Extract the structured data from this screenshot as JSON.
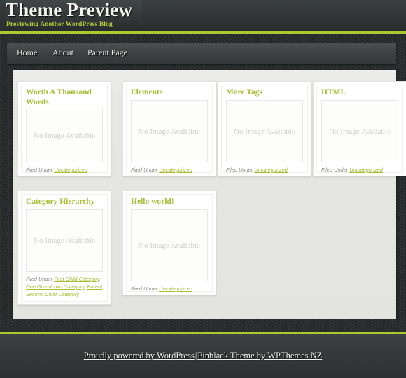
{
  "site": {
    "title": "Theme Preview",
    "description": "Previewing Another WordPress Blog",
    "accent_color": "#aec92c",
    "title_color": "#f4f4f0",
    "background_color": "#2c3030"
  },
  "nav": {
    "items": [
      {
        "label": "Home"
      },
      {
        "label": "About"
      },
      {
        "label": "Parent Page"
      }
    ]
  },
  "posts": [
    {
      "title": "Worth A Thousand Words",
      "thumb_label": "No Image Available",
      "filed_under_label": "Filed Under",
      "categories": [
        "Uncategorized"
      ]
    },
    {
      "title": "Elements",
      "thumb_label": "No Image Available",
      "filed_under_label": "Filed Under",
      "categories": [
        "Uncategorized"
      ]
    },
    {
      "title": "More Tags",
      "thumb_label": "No Image Available",
      "filed_under_label": "Filed Under",
      "categories": [
        "Uncategorized"
      ]
    },
    {
      "title": "HTML",
      "thumb_label": "No Image Available",
      "filed_under_label": "Filed Under",
      "categories": [
        "Uncategorized"
      ]
    },
    {
      "title": "Category Hierarchy",
      "thumb_label": "No Image Available",
      "filed_under_label": "Filed Under",
      "categories": [
        "First Child Category",
        "One Grandchild Category",
        "Parent",
        "Second Child Category"
      ]
    },
    {
      "title": "Hello world!",
      "thumb_label": "No Image Available",
      "filed_under_label": "Filed Under",
      "categories": [
        "Uncategorized"
      ]
    }
  ],
  "footer": {
    "wordpress_link": "Proudly powered by WordPress",
    "separator": "|",
    "theme_link": "Pinblack Theme by WPThemes NZ"
  }
}
